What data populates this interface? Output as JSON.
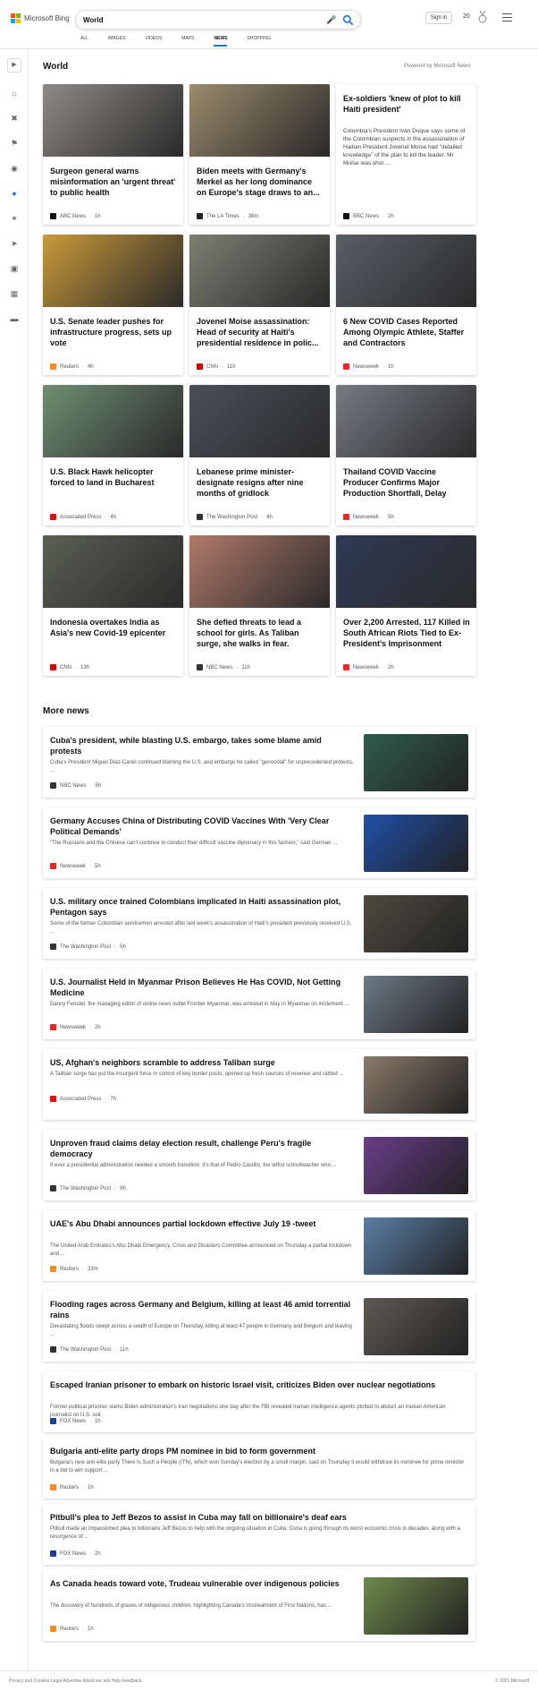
{
  "header": {
    "logo_text": "Microsoft Bing",
    "search_value": "World",
    "signin_label": "Sign in",
    "points": "20",
    "nav": [
      "ALL",
      "IMAGES",
      "VIDEOS",
      "MAPS",
      "NEWS",
      "SHOPPING"
    ],
    "active_nav": "NEWS"
  },
  "section": {
    "title": "World",
    "powered_by": "Powered by Microsoft News"
  },
  "cards": [
    {
      "title": "Surgeon general warns misinformation an 'urgent threat' to public health",
      "source": "ABC News",
      "time": "1h",
      "img_color": "#8d8a86",
      "badge_color": "#111"
    },
    {
      "title": "Biden meets with Germany's Merkel as her long dominance on Europe's stage draws to an...",
      "source": "The LA Times",
      "time": "39m",
      "img_color": "#9a8b6c",
      "badge_color": "#222"
    },
    {
      "title": "Ex-soldiers 'knew of plot to kill Haiti president'",
      "snippet": "Colombia's President Iván Duque says some of the Colombian suspects in the assassination of Haitian President Jovenel Moïse had \"detailed knowledge\" of the plan to kill the leader. Mr Moïse was shot ...",
      "source": "BBC News",
      "time": "2h",
      "img_color": "",
      "badge_color": "#111"
    },
    {
      "title": "U.S. Senate leader pushes for infrastructure progress, sets up vote",
      "source": "Reuters",
      "time": "4h",
      "img_color": "#c99a3a",
      "badge_color": "#f28c28"
    },
    {
      "title": "Jovenel Moise assassination: Head of security at Haiti's presidential residence in polic...",
      "source": "CNN",
      "time": "11h",
      "img_color": "#7d7f72",
      "badge_color": "#cc0000"
    },
    {
      "title": "6 New COVID Cases Reported Among Olympic Athlete, Staffer and Contractors",
      "source": "Newsweek",
      "time": "1h",
      "img_color": "#5a5e66",
      "badge_color": "#e12b2b"
    },
    {
      "title": "U.S. Black Hawk helicopter forced to land in Bucharest",
      "source": "Associated Press",
      "time": "4h",
      "img_color": "#6f8f72",
      "badge_color": "#d11"
    },
    {
      "title": "Lebanese prime minister-designate resigns after nine months of gridlock",
      "source": "The Washington Post",
      "time": "4h",
      "img_color": "#4b4f58",
      "badge_color": "#333"
    },
    {
      "title": "Thailand COVID Vaccine Producer Confirms Major Production Shortfall, Delay",
      "source": "Newsweek",
      "time": "5h",
      "img_color": "#777a82",
      "badge_color": "#e12b2b"
    },
    {
      "title": "Indonesia overtakes India as Asia's new Covid-19 epicenter",
      "source": "CNN",
      "time": "13h",
      "img_color": "#5b5f52",
      "badge_color": "#cc0000"
    },
    {
      "title": "She defied threats to lead a school for girls. As Taliban surge, she walks in fear.",
      "source": "NBC News",
      "time": "11h",
      "img_color": "#b07a6a",
      "badge_color": "#333"
    },
    {
      "title": "Over 2,200 Arrested, 117 Killed in South African Riots Tied to Ex-President's Imprisonment",
      "source": "Newsweek",
      "time": "2h",
      "img_color": "#2e3a55",
      "badge_color": "#e12b2b"
    }
  ],
  "more_news": {
    "title": "More news",
    "items": [
      {
        "title": "Cuba's president, while blasting U.S. embargo, takes some blame amid protests",
        "snippet": "Cuba's President Miguel Díaz-Canel continued blaming the U.S. and embargo he called \"genocidal\" for unprecedented protests, ...",
        "source": "NBC News",
        "time": "5h",
        "thumb_color": "#2f5d4d",
        "badge_color": "#333"
      },
      {
        "title": "Germany Accuses China of Distributing COVID Vaccines With 'Very Clear Political Demands'",
        "snippet": "\"The Russians and the Chinese can't continue to conduct their difficult vaccine diplomacy in this fashion,\" said German ...",
        "source": "Newsweek",
        "time": "5h",
        "thumb_color": "#1f4fa8",
        "badge_color": "#e12b2b"
      },
      {
        "title": "U.S. military once trained Colombians implicated in Haiti assassination plot, Pentagon says",
        "snippet": "Some of the former Colombian servicemen arrested after last week's assassination of Haiti's president previously received U.S. ...",
        "source": "The Washington Post",
        "time": "5h",
        "thumb_color": "#4d4a3e",
        "badge_color": "#333"
      },
      {
        "title": "U.S. Journalist Held in Myanmar Prison Believes He Has COVID, Not Getting Medicine",
        "snippet": "Danny Fenster, the managing editor of online news outlet Frontier Myanmar, was arrested in May in Myanmar on incitement ...",
        "source": "Newsweek",
        "time": "2h",
        "thumb_color": "#6c7a86",
        "badge_color": "#e12b2b"
      },
      {
        "title": "US, Afghan's neighbors scramble to address Taliban surge",
        "snippet": "A Taliban surge has put the insurgent force in control of key border posts, opened up fresh sources of revenue and rattled ...",
        "source": "Associated Press",
        "time": "7h",
        "thumb_color": "#8a7a6a",
        "badge_color": "#d11"
      },
      {
        "title": "Unproven fraud claims delay election result, challenge Peru's fragile democracy",
        "snippet": "If ever a presidential administration needed a smooth transition, it's that of Pedro Castillo, the leftist schoolteacher who ...",
        "source": "The Washington Post",
        "time": "9h",
        "thumb_color": "#6a3d8a",
        "badge_color": "#333"
      },
      {
        "title": "UAE's Abu Dhabi announces partial lockdown effective July 19 -tweet",
        "snippet": "The United Arab Emirates's Abu Dhabi Emergency, Crisis and Disasters Committee announced on Thursday a partial lockdown and ...",
        "source": "Reuters",
        "time": "33m",
        "thumb_color": "#5a7fa6",
        "badge_color": "#f28c28"
      },
      {
        "title": "Flooding rages across Germany and Belgium, killing at least 46 amid torrential rains",
        "snippet": "Devastating floods swept across a swath of Europe on Thursday, killing at least 47 people in Germany and Belgium and leaving ...",
        "source": "The Washington Post",
        "time": "11h",
        "thumb_color": "#5e5a55",
        "badge_color": "#333"
      },
      {
        "title": "Escaped Iranian prisoner to embark on historic Israel visit, criticizes Biden over nuclear negotiations",
        "snippet": "Former political prisoner slams Biden administration's Iran negotiations one day after the FBI revealed Iranian intelligence agents plotted to abduct an Iranian American journalist on U.S. soil.",
        "source": "FOX News",
        "time": "1h",
        "thumb_color": "",
        "badge_color": "#1c3f94"
      },
      {
        "title": "Bulgaria anti-elite party drops PM nominee in bid to form government",
        "snippet": "Bulgaria's new anti-elite party There Is Such a People (ITN), which won Sunday's election by a small margin, said on Thursday it would withdraw its nominee for prime minister in a bid to win support ...",
        "source": "Reuters",
        "time": "1h",
        "thumb_color": "",
        "badge_color": "#f28c28"
      },
      {
        "title": "Pitbull's plea to Jeff Bezos to assist in Cuba may fall on billionaire's deaf ears",
        "snippet": "Pitbull made an impassioned plea to billionaire Jeff Bezos to help with the ongoing situation in Cuba. Cuba is going through its worst economic crisis in decades, along with a resurgence of ...",
        "source": "FOX News",
        "time": "2h",
        "thumb_color": "",
        "badge_color": "#1c3f94"
      },
      {
        "title": "As Canada heads toward vote, Trudeau vulnerable over indigenous policies",
        "snippet": "The discovery of hundreds of graves of indigenous children, highlighting Canada's mistreatment of First Nations, has ...",
        "source": "Reuters",
        "time": "1h",
        "thumb_color": "#6e8a4a",
        "badge_color": "#f28c28"
      }
    ]
  },
  "footer": {
    "left": "Privacy and Cookies   Legal   Advertise   About our ads   Help   Feedback",
    "right": "© 2021 Microsoft"
  }
}
